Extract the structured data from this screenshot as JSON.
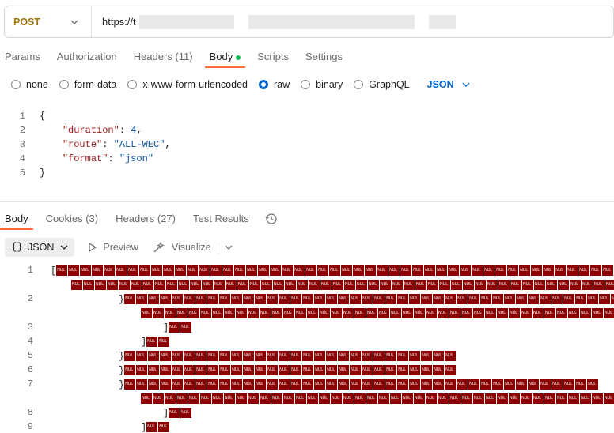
{
  "request": {
    "method": "POST",
    "url_visible": "https://t"
  },
  "request_tabs": [
    {
      "label": "Params",
      "active": false
    },
    {
      "label": "Authorization",
      "active": false
    },
    {
      "label": "Headers (11)",
      "active": false
    },
    {
      "label": "Body",
      "active": true,
      "has_dot": true
    },
    {
      "label": "Scripts",
      "active": false
    },
    {
      "label": "Settings",
      "active": false
    }
  ],
  "body_types": [
    {
      "label": "none",
      "selected": false
    },
    {
      "label": "form-data",
      "selected": false
    },
    {
      "label": "x-www-form-urlencoded",
      "selected": false
    },
    {
      "label": "raw",
      "selected": true
    },
    {
      "label": "binary",
      "selected": false
    },
    {
      "label": "GraphQL",
      "selected": false
    }
  ],
  "body_format": "JSON",
  "editor_lines": [
    {
      "num": "1",
      "text": "{"
    },
    {
      "num": "2",
      "key": "\"duration\"",
      "value": "4",
      "type": "number"
    },
    {
      "num": "3",
      "key": "\"route\"",
      "value": "\"ALL-WEC\"",
      "type": "string"
    },
    {
      "num": "4",
      "key": "\"format\"",
      "value": "\"json\"",
      "type": "string"
    },
    {
      "num": "5",
      "text": "}"
    }
  ],
  "response_tabs": [
    {
      "label": "Body",
      "active": true
    },
    {
      "label": "Cookies (3)",
      "active": false
    },
    {
      "label": "Headers (27)",
      "active": false
    },
    {
      "label": "Test Results",
      "active": false
    }
  ],
  "response_toolbar": {
    "format_label": "JSON",
    "format_icon": "{}",
    "preview_label": "Preview",
    "visualize_label": "Visualize"
  },
  "nul_glyph": "NUL",
  "response_line_numbers": [
    "1",
    "2",
    "3",
    "4",
    "5",
    "6",
    "7",
    "8",
    "9"
  ],
  "colors": {
    "method": "#a0760b",
    "accent_blue": "#0265d2",
    "active_tab_underline": "#ff6c37",
    "body_dot": "#0cbb52",
    "nul_block": "#8b0000",
    "json_key": "#951616",
    "json_value": "#0b53a5"
  }
}
